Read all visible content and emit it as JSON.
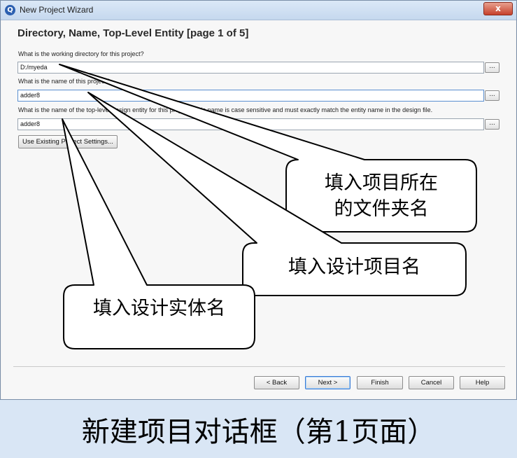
{
  "window": {
    "title": "New Project Wizard",
    "icon": "quartus-icon",
    "close_label": "x"
  },
  "page": {
    "heading": "Directory, Name, Top-Level Entity [page 1 of 5]",
    "dir_label": "What is the working directory for this project?",
    "dir_value": "D:/myeda",
    "name_label": "What is the name of this project?",
    "name_value": "adder8",
    "entity_label": "What is the name of the top-level design entity for this project? This name is case sensitive and must exactly match the entity name in the design file.",
    "entity_value": "adder8",
    "browse_label": "...",
    "existing_label": "Use Existing Project Settings..."
  },
  "footer": {
    "back_label": "< Back",
    "next_label": "Next >",
    "finish_label": "Finish",
    "cancel_label": "Cancel",
    "help_label": "Help"
  },
  "callouts": {
    "dir_line1": "填入项目所在",
    "dir_line2": "的文件夹名",
    "name": "填入设计项目名",
    "entity": "填入设计实体名"
  },
  "caption": "新建项目对话框（第1页面）",
  "colors": {
    "background": "#d9e6f5",
    "close": "#c6412b",
    "accent": "#3a7bd5"
  }
}
